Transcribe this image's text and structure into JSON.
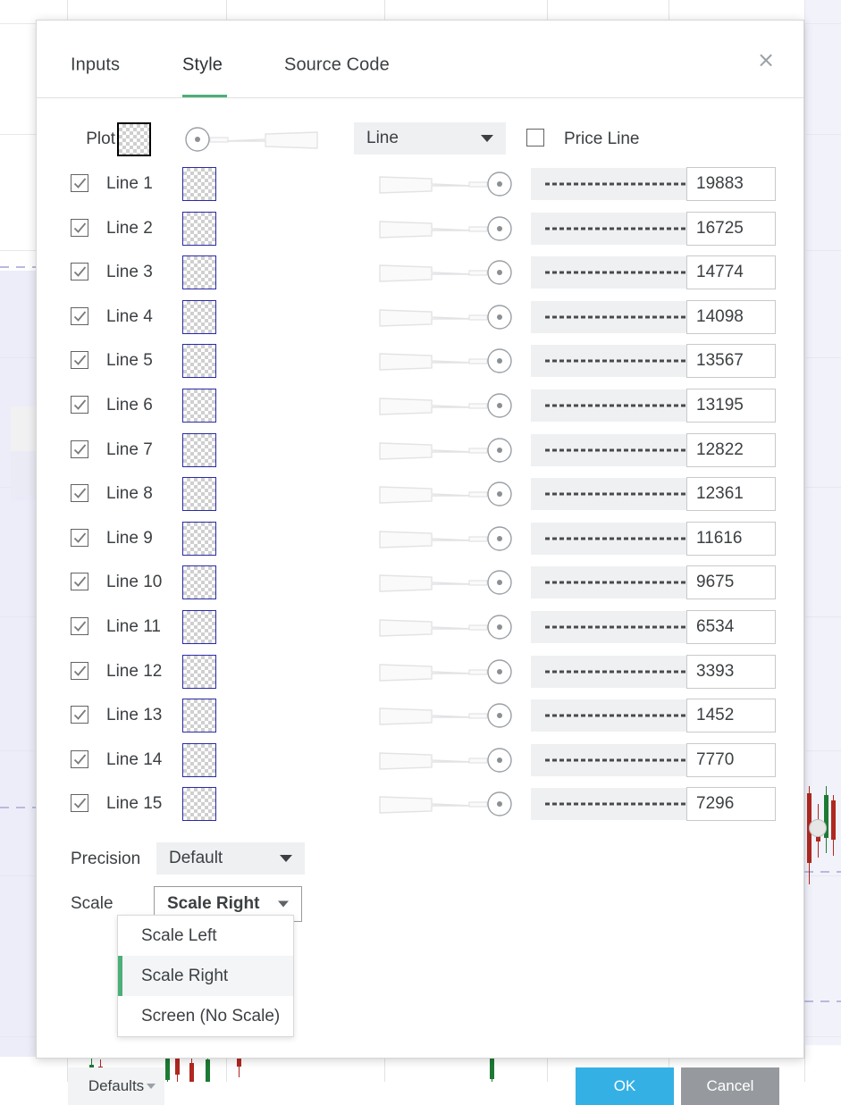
{
  "background": {
    "description": "candlestick price chart behind modal"
  },
  "dialog": {
    "tabs": [
      {
        "label": "Inputs",
        "active": false
      },
      {
        "label": "Style",
        "active": true
      },
      {
        "label": "Source Code",
        "active": false
      }
    ],
    "close_icon": "×",
    "plot_row": {
      "label": "Plot",
      "swatch_name": "plot-color-swatch",
      "thickness_knob": "left",
      "type_select": "Line",
      "price_line_label": "Price Line",
      "price_line_checked": false
    },
    "lines": [
      {
        "label": "Line 1",
        "checked": true,
        "value": "19883"
      },
      {
        "label": "Line 2",
        "checked": true,
        "value": "16725"
      },
      {
        "label": "Line 3",
        "checked": true,
        "value": "14774"
      },
      {
        "label": "Line 4",
        "checked": true,
        "value": "14098"
      },
      {
        "label": "Line 5",
        "checked": true,
        "value": "13567"
      },
      {
        "label": "Line 6",
        "checked": true,
        "value": "13195"
      },
      {
        "label": "Line 7",
        "checked": true,
        "value": "12822"
      },
      {
        "label": "Line 8",
        "checked": true,
        "value": "12361"
      },
      {
        "label": "Line 9",
        "checked": true,
        "value": "11616"
      },
      {
        "label": "Line 10",
        "checked": true,
        "value": "9675"
      },
      {
        "label": "Line 11",
        "checked": true,
        "value": "6534"
      },
      {
        "label": "Line 12",
        "checked": true,
        "value": "3393"
      },
      {
        "label": "Line 13",
        "checked": true,
        "value": "1452"
      },
      {
        "label": "Line 14",
        "checked": true,
        "value": "7770"
      },
      {
        "label": "Line 15",
        "checked": true,
        "value": "7296"
      }
    ],
    "precision": {
      "label": "Precision",
      "value": "Default"
    },
    "scale": {
      "label": "Scale",
      "value": "Scale Right",
      "open": true,
      "options": [
        {
          "label": "Scale Left",
          "selected": false
        },
        {
          "label": "Scale Right",
          "selected": true
        },
        {
          "label": "Screen (No Scale)",
          "selected": false
        }
      ]
    },
    "footer": {
      "defaults_label": "Defaults",
      "ok_label": "OK",
      "cancel_label": "Cancel"
    }
  },
  "colors": {
    "accent_green": "#4caf78",
    "ok_blue": "#35b0e5",
    "cancel_gray": "#969a9e",
    "swatch_border_plot": "#000000",
    "swatch_border_line": "#2a2aa8",
    "select_bg": "#eef0f2"
  }
}
